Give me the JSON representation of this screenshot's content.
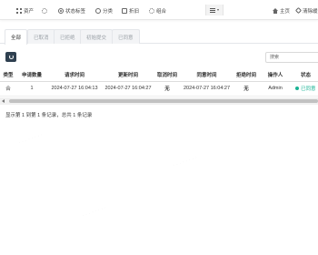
{
  "topnav": {
    "items": [
      {
        "label": "资产",
        "icon": "grid-icon"
      },
      {
        "label": "",
        "icon": "gear-icon"
      },
      {
        "label": "状态标签",
        "icon": "target-icon"
      },
      {
        "label": "分类",
        "icon": "circle-icon"
      },
      {
        "label": "折旧",
        "icon": "box-icon"
      },
      {
        "label": "组合",
        "icon": "gear-icon"
      }
    ],
    "menu_toggle": "menu-icon",
    "home_label": "主页",
    "clear_label": "清除缓"
  },
  "tabs": [
    {
      "label": "全部",
      "active": true
    },
    {
      "label": "已取消",
      "active": false
    },
    {
      "label": "已拒绝",
      "active": false
    },
    {
      "label": "初始提交",
      "active": false
    },
    {
      "label": "已同意",
      "active": false
    }
  ],
  "toolbar": {
    "search_placeholder": "搜索"
  },
  "table": {
    "columns": [
      "类型",
      "申请数量",
      "请求时间",
      "更新时间",
      "取消时间",
      "同意时间",
      "拒绝时间",
      "操作人",
      "状态"
    ],
    "rows": [
      {
        "type": "合",
        "qty": "1",
        "request_time": "2024-07-27 16:04:13",
        "update_time": "2024-07-27 16:04:27",
        "cancel_time": "无",
        "agree_time": "2024-07-27 16:04:27",
        "reject_time": "无",
        "operator": "Admin",
        "status": "已同意",
        "status_color": "#1ab394"
      }
    ]
  },
  "pagination": {
    "info": "显示第 1 到第 1 条记录，总共 1 条记录"
  },
  "colors": {
    "primary_dark": "#2f4050",
    "success": "#1ab394"
  }
}
